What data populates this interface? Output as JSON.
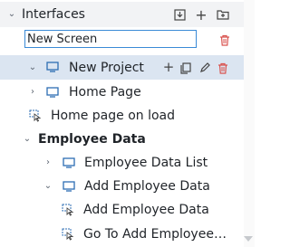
{
  "section": {
    "title": "Interfaces"
  },
  "new_screen_input": {
    "value": "New Screen"
  },
  "tree": {
    "project": {
      "label": "New Project"
    },
    "home_page": {
      "label": "Home Page"
    },
    "home_on_load": {
      "label": "Home page on load"
    },
    "employee_data": {
      "label": "Employee Data"
    },
    "employee_data_list": {
      "label": "Employee Data List"
    },
    "add_employee_data_screen": {
      "label": "Add Employee Data"
    },
    "add_employee_data_action": {
      "label": "Add Employee Data"
    },
    "go_to_add_employee": {
      "label": "Go To Add Employee D..."
    }
  },
  "colors": {
    "accent": "#3a8ad6",
    "delete": "#d9534f",
    "selected_bg": "#dbe5f1",
    "header_bg": "#f2f3f5"
  }
}
